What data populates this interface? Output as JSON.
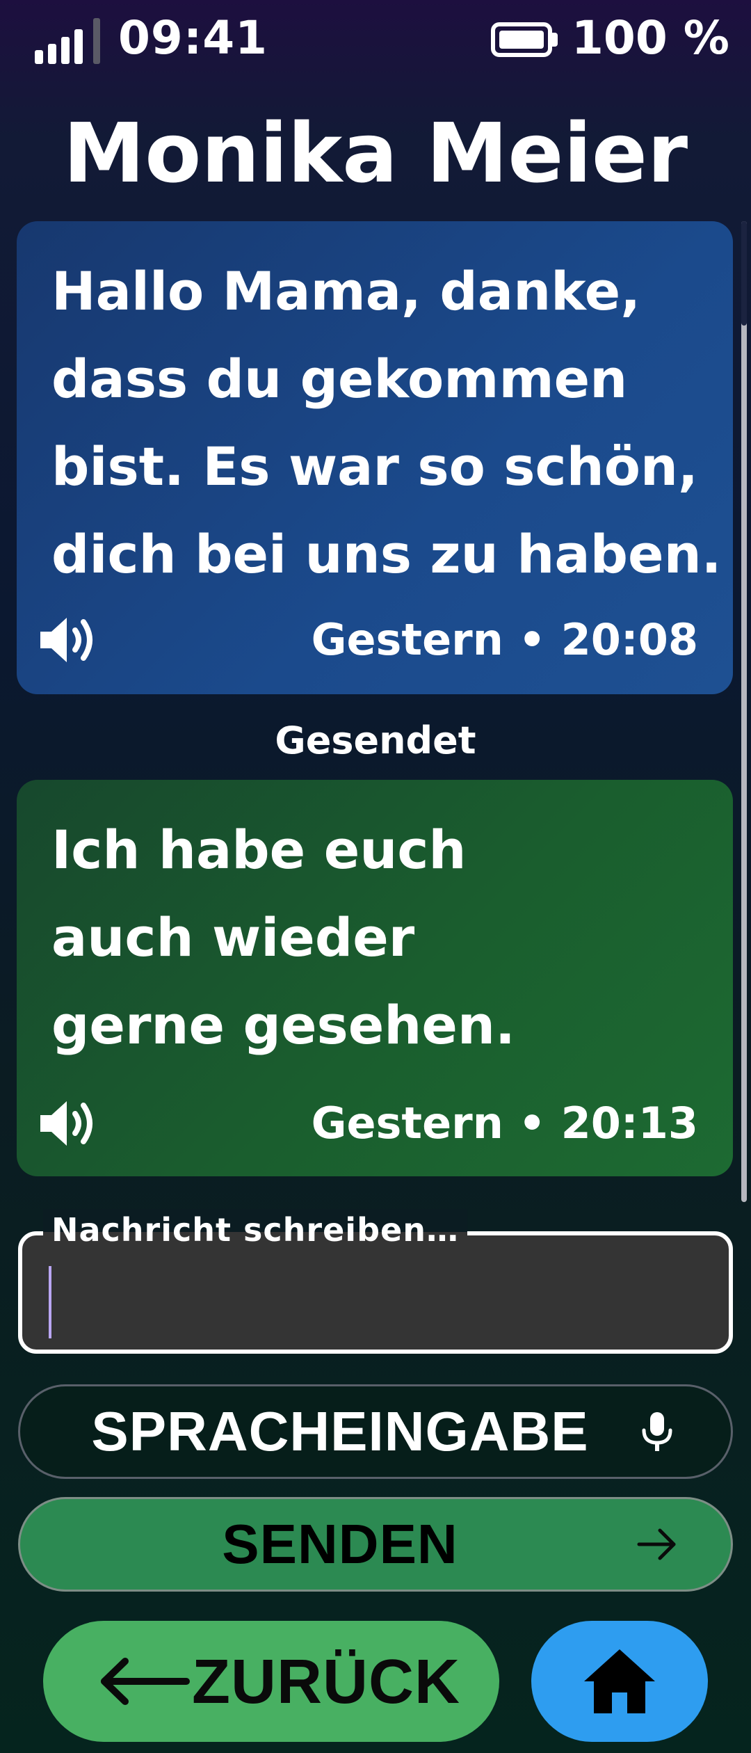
{
  "status_bar": {
    "time": "09:41",
    "battery_percent": "100 %",
    "signal_bars": 4,
    "icons": [
      "signal-icon",
      "battery-icon"
    ]
  },
  "contact": {
    "name": "Monika Meier"
  },
  "messages": [
    {
      "direction": "received",
      "text": "Hallo Mama, danke,\ndass du gekommen\nbist. Es war so schön,\ndich bei uns zu haben.",
      "timestamp": "Gestern • 20:08",
      "icon": "speaker-icon",
      "color": "#1b4a8c"
    },
    {
      "direction": "sent",
      "status": "Gesendet",
      "text": "Ich habe euch\nauch wieder\ngerne gesehen.",
      "timestamp": "Gestern • 20:13",
      "icon": "speaker-icon",
      "color": "#1a5e2e"
    }
  ],
  "compose": {
    "label": "Nachricht schreiben…",
    "value": ""
  },
  "buttons": {
    "voice": {
      "label": "SPRACHEINGABE",
      "icon": "microphone-icon"
    },
    "send": {
      "label": "SENDEN",
      "icon": "arrow-right-icon",
      "color": "#2c8a52"
    },
    "back": {
      "label": "ZURÜCK",
      "icon": "arrow-left-icon",
      "color": "#48b062"
    },
    "home": {
      "icon": "home-icon",
      "color": "#2e9df0"
    }
  }
}
